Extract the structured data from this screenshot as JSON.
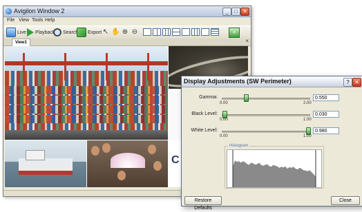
{
  "window": {
    "title": "Avigilon Window 2",
    "controls": {
      "minimize": "_",
      "maximize": "□",
      "close": "✕"
    }
  },
  "menu": [
    "File",
    "View",
    "Tools",
    "Help"
  ],
  "toolbar": {
    "live": "Live",
    "playback": "Playback",
    "search": "Search",
    "export": "Export"
  },
  "tab": {
    "label": "View1",
    "close": "×"
  },
  "camera_overlay_text": "C",
  "dialog": {
    "title": "Display Adjustments (SW Perimeter)",
    "help": "?",
    "close": "✕",
    "gamma": {
      "label": "Gamma:",
      "min": "0.00",
      "max": "2.00",
      "value": "0.550",
      "level": 0.275
    },
    "black": {
      "label": "Black Level:",
      "min": "0.00",
      "max": "1.00",
      "value": "0.030",
      "level": 0.03
    },
    "white": {
      "label": "White Level:",
      "min": "0.00",
      "max": "1.00",
      "value": "0.980",
      "level": 0.98
    },
    "histogram_label": "Histogram",
    "histogram_values": [
      0.55,
      0.72,
      0.68,
      0.7,
      0.66,
      0.7,
      0.67,
      0.63,
      0.6,
      0.66,
      0.64,
      0.61,
      0.62,
      0.66,
      0.6,
      0.58,
      0.6,
      0.62,
      0.57,
      0.55,
      0.6,
      0.58,
      0.56,
      0.52,
      0.55,
      0.53,
      0.56,
      0.5,
      0.54,
      0.52,
      0.55,
      0.5,
      0.48,
      0.52,
      0.5,
      0.46,
      0.45,
      0.43,
      0.46,
      0.4,
      0.35,
      0.28
    ],
    "restore_defaults": "Restore Defaults",
    "close_button": "Close"
  }
}
